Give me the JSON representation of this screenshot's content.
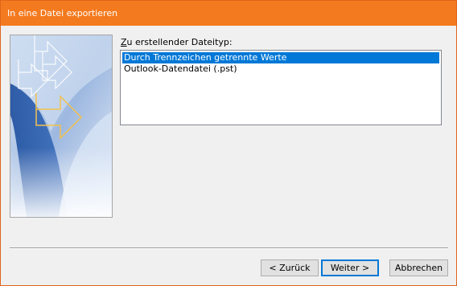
{
  "window": {
    "title": "In eine Datei exportieren"
  },
  "form": {
    "type_label_accel": "Z",
    "type_label_rest": "u erstellender Dateityp:",
    "file_types": [
      {
        "label": "Durch Trennzeichen getrennte Werte",
        "selected": true
      },
      {
        "label": "Outlook-Datendatei (.pst)",
        "selected": false
      }
    ]
  },
  "buttons": {
    "back": "< Zurück",
    "next": "Weiter >",
    "cancel": "Abbrechen"
  },
  "colors": {
    "titlebar": "#f47a1f",
    "selection": "#0078d7",
    "default_button_border": "#0078d7",
    "banner_blue": "#2e5aa8",
    "banner_arrow_outline": "#f2c14e"
  }
}
